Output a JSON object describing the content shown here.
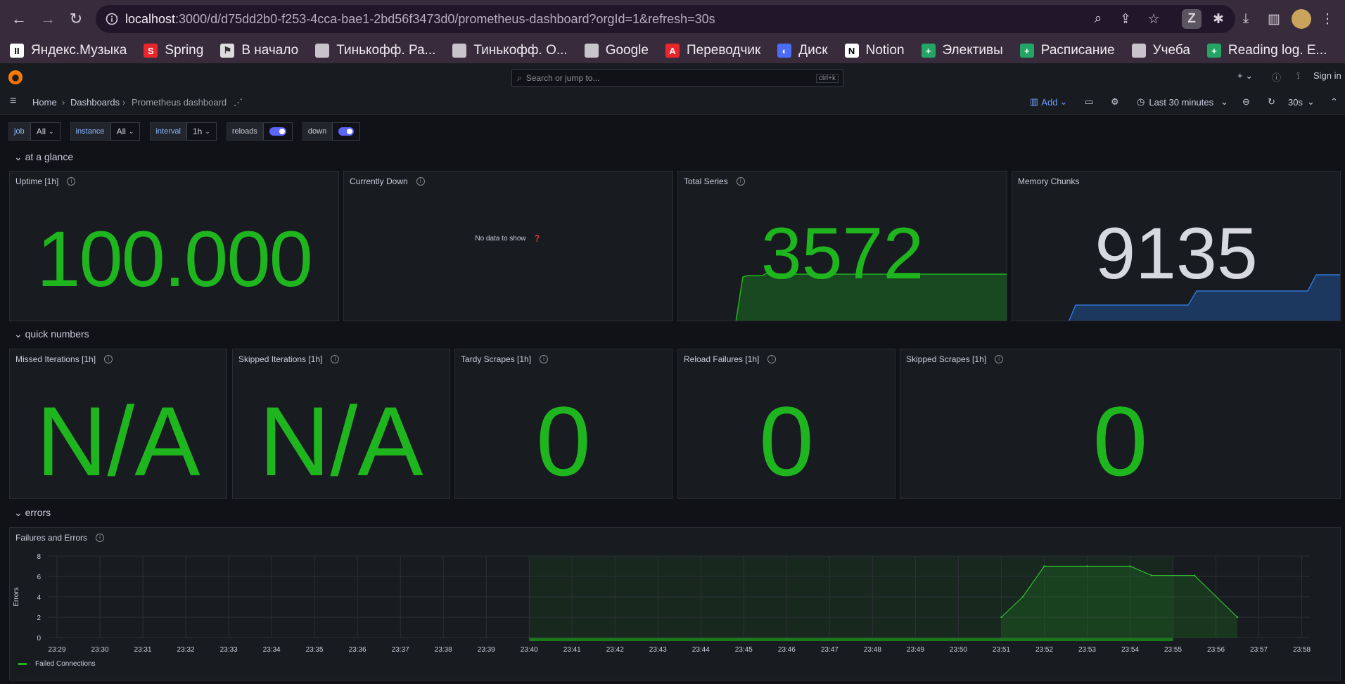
{
  "browser": {
    "url_host": "localhost",
    "url_rest": ":3000/d/d75dd2b0-f253-4cca-bae1-2bd56f3473d0/prometheus-dashboard?orgId=1&refresh=30s",
    "bookmarks": [
      {
        "label": "Яндекс.Музыка",
        "color": "#ffffff",
        "text": "#000",
        "glyph": "II"
      },
      {
        "label": "Spring",
        "color": "#e8262c",
        "text": "#fff",
        "glyph": "S"
      },
      {
        "label": "В начало",
        "color": "#dcdcdc",
        "text": "#333",
        "glyph": "⚑"
      },
      {
        "label": "Тинькофф. Ра...",
        "color": "#c9c3cc",
        "text": "#333",
        "glyph": ""
      },
      {
        "label": "Тинькофф. О...",
        "color": "#c9c3cc",
        "text": "#333",
        "glyph": ""
      },
      {
        "label": "Google",
        "color": "#c9c3cc",
        "text": "#333",
        "glyph": ""
      },
      {
        "label": "Переводчик",
        "color": "#e8262c",
        "text": "#fff",
        "glyph": "A"
      },
      {
        "label": "Диск",
        "color": "#4a6cf7",
        "text": "#fff",
        "glyph": "◐"
      },
      {
        "label": "Notion",
        "color": "#ffffff",
        "text": "#000",
        "glyph": "N"
      },
      {
        "label": "Элективы",
        "color": "#23a566",
        "text": "#fff",
        "glyph": "+"
      },
      {
        "label": "Расписание",
        "color": "#23a566",
        "text": "#fff",
        "glyph": "+"
      },
      {
        "label": "Учеба",
        "color": "#c9c3cc",
        "text": "#333",
        "glyph": ""
      },
      {
        "label": "Reading log. E...",
        "color": "#23a566",
        "text": "#fff",
        "glyph": "+"
      }
    ]
  },
  "grafana": {
    "search_placeholder": "Search or jump to...",
    "search_shortcut": "ctrl+k",
    "sign_in": "Sign in",
    "breadcrumbs": [
      "Home",
      "Dashboards",
      "Prometheus dashboard"
    ],
    "toolbar": {
      "add": "Add",
      "time_range": "Last 30 minutes",
      "refresh": "30s"
    },
    "variables": [
      {
        "label": "job",
        "value": "All"
      },
      {
        "label": "instance",
        "value": "All"
      },
      {
        "label": "interval",
        "value": "1h"
      }
    ],
    "toggles": [
      "reloads",
      "down"
    ]
  },
  "rows": {
    "glance": "at a glance",
    "quick": "quick numbers",
    "errors": "errors"
  },
  "stats": {
    "uptime": {
      "title": "Uptime [1h]",
      "value": "100.000"
    },
    "down": {
      "title": "Currently Down",
      "nodata": "No data to show"
    },
    "total_series": {
      "title": "Total Series",
      "value": "3572"
    },
    "memory_chunks": {
      "title": "Memory Chunks",
      "value": "9135"
    },
    "missed": {
      "title": "Missed Iterations [1h]",
      "value": "N/A"
    },
    "skipped_iter": {
      "title": "Skipped Iterations [1h]",
      "value": "N/A"
    },
    "tardy": {
      "title": "Tardy Scrapes [1h]",
      "value": "0"
    },
    "reload_fail": {
      "title": "Reload Failures [1h]",
      "value": "0"
    },
    "skipped_scrapes": {
      "title": "Skipped Scrapes [1h]",
      "value": "0"
    }
  },
  "colors": {
    "green": "#1fb51f",
    "white": "#d8d9e0",
    "blue_area": "#1f3d6b"
  },
  "chart_data": {
    "type": "area",
    "title": "Failures and Errors",
    "ylabel": "Errors",
    "ylim": [
      0,
      8
    ],
    "yticks": [
      0,
      2,
      4,
      6,
      8
    ],
    "x": [
      "23:29",
      "23:30",
      "23:31",
      "23:32",
      "23:33",
      "23:34",
      "23:35",
      "23:36",
      "23:37",
      "23:38",
      "23:39",
      "23:40",
      "23:41",
      "23:42",
      "23:43",
      "23:44",
      "23:45",
      "23:46",
      "23:47",
      "23:48",
      "23:49",
      "23:50",
      "23:51",
      "23:52",
      "23:53",
      "23:54",
      "23:55",
      "23:56",
      "23:57",
      "23:58"
    ],
    "series": [
      {
        "name": "Failed Connections",
        "points": [
          [
            22.0,
            2
          ],
          [
            22.5,
            4
          ],
          [
            23.0,
            7
          ],
          [
            24.0,
            7
          ],
          [
            25.0,
            7
          ],
          [
            25.5,
            6.1
          ],
          [
            26.5,
            6.1
          ],
          [
            27.5,
            2
          ]
        ]
      }
    ],
    "shaded_region": [
      "23:40",
      "23:55"
    ]
  }
}
